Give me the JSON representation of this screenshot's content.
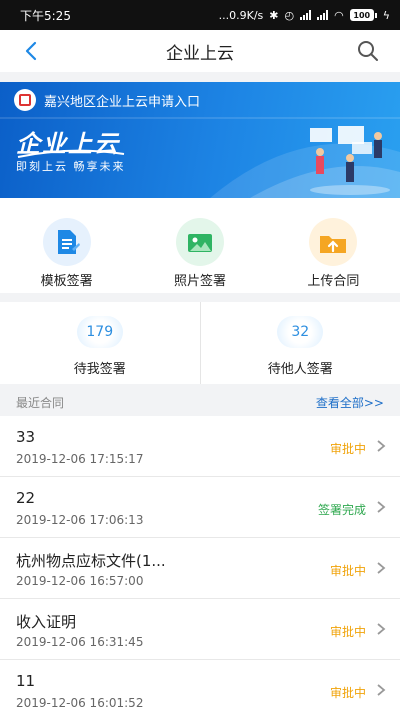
{
  "status_bar": {
    "time": "下午5:25",
    "net_speed": "...0.9K/s",
    "battery": "100"
  },
  "nav": {
    "title": "企业上云"
  },
  "banner": {
    "header_text": "嘉兴地区企业上云申请入口",
    "title": "企业上云",
    "slogan": "即刻上云 畅享未来"
  },
  "actions": [
    {
      "label": "模板签署",
      "icon": "document-icon",
      "color": "#1e88e5"
    },
    {
      "label": "照片签署",
      "icon": "photo-icon",
      "color": "#2fb463"
    },
    {
      "label": "上传合同",
      "icon": "folder-upload-icon",
      "color": "#f5a623"
    }
  ],
  "counts": [
    {
      "value": "179",
      "label": "待我签署"
    },
    {
      "value": "32",
      "label": "待他人签署"
    }
  ],
  "recent": {
    "title": "最近合同",
    "view_all": "查看全部>>"
  },
  "contracts": [
    {
      "name": "33",
      "time": "2019-12-06 17:15:17",
      "status": "审批中",
      "status_type": "pending"
    },
    {
      "name": "22",
      "time": "2019-12-06 17:06:13",
      "status": "签署完成",
      "status_type": "done"
    },
    {
      "name": "杭州物点应标文件(1...",
      "time": "2019-12-06 16:57:00",
      "status": "审批中",
      "status_type": "pending"
    },
    {
      "name": "收入证明",
      "time": "2019-12-06 16:31:45",
      "status": "审批中",
      "status_type": "pending"
    },
    {
      "name": "11",
      "time": "2019-12-06 16:01:52",
      "status": "审批中",
      "status_type": "pending"
    }
  ],
  "colors": {
    "accent": "#1f6fc8",
    "pending": "#f0a30a",
    "done": "#2fa84f"
  }
}
